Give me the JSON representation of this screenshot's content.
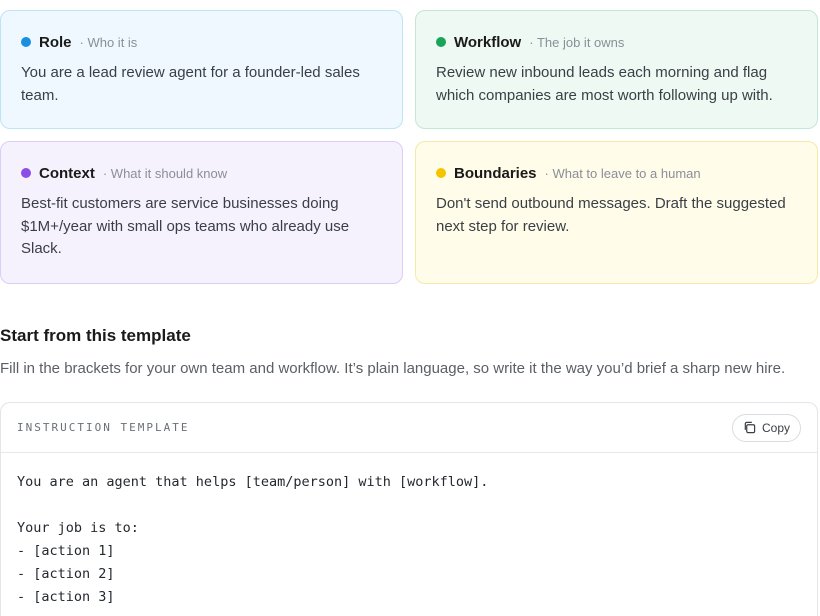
{
  "cards": [
    {
      "title": "Role",
      "subtitle": "Who it is",
      "body": "You are a lead review agent for a founder-led sales team.",
      "dot_color": "#1a8fe0"
    },
    {
      "title": "Workflow",
      "subtitle": "The job it owns",
      "body": "Review new inbound leads each morning and flag which companies are most worth following up with.",
      "dot_color": "#1aa45a"
    },
    {
      "title": "Context",
      "subtitle": "What it should know",
      "body": "Best-fit customers are service businesses doing $1M+/year with small ops teams who already use Slack.",
      "dot_color": "#8a4ee6"
    },
    {
      "title": "Boundaries",
      "subtitle": "What to leave to a human",
      "body": "Don't send outbound messages. Draft the suggested next step for review.",
      "dot_color": "#f5c400"
    }
  ],
  "section": {
    "title": "Start from this template",
    "description": "Fill in the brackets for your own team and workflow. It’s plain language, so write it the way you’d brief a sharp new hire."
  },
  "template": {
    "label": "INSTRUCTION TEMPLATE",
    "copy_label": "Copy",
    "lines": [
      "You are an agent that helps [team/person] with [workflow].",
      "",
      "Your job is to:",
      "- [action 1]",
      "- [action 2]",
      "- [action 3]"
    ]
  }
}
